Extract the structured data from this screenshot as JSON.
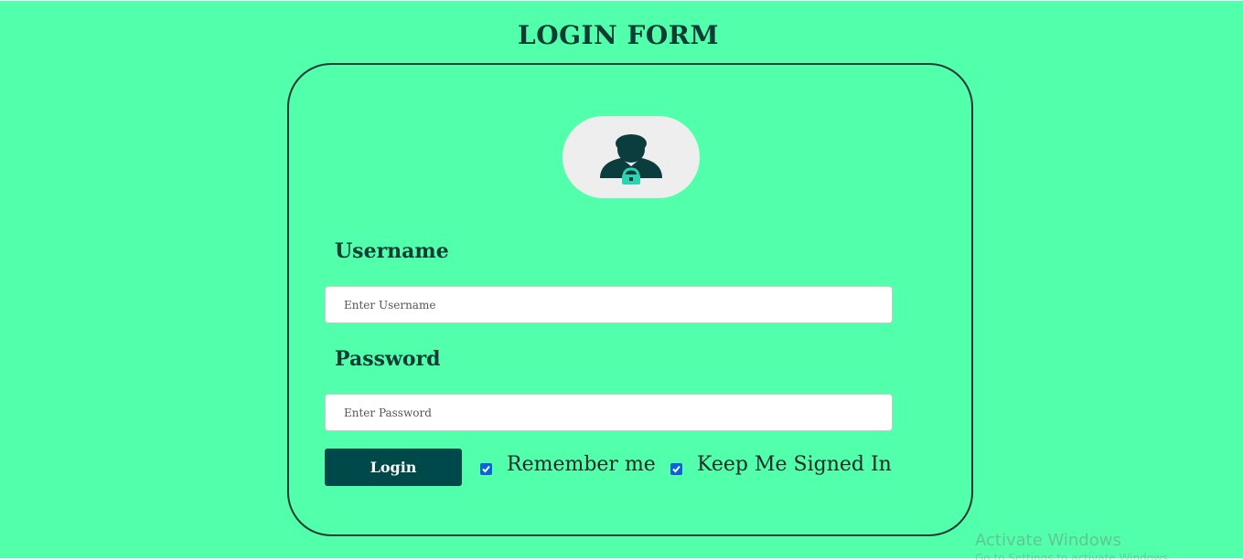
{
  "page": {
    "title": "LOGIN FORM",
    "background_color": "#52ffaa",
    "accent_color": "#00494a"
  },
  "avatar": {
    "icon": "user-lock-icon"
  },
  "form": {
    "username_label": "Username",
    "username_placeholder": "Enter Username",
    "username_value": "",
    "password_label": "Password",
    "password_placeholder": "Enter Password",
    "password_value": "",
    "login_label": "Login",
    "remember_label": "Remember me",
    "remember_checked": true,
    "keep_signed_label": "Keep Me Signed In",
    "keep_signed_checked": true
  },
  "os_watermark": {
    "title": "Activate Windows",
    "subtitle": "Go to Settings to activate Windows."
  }
}
